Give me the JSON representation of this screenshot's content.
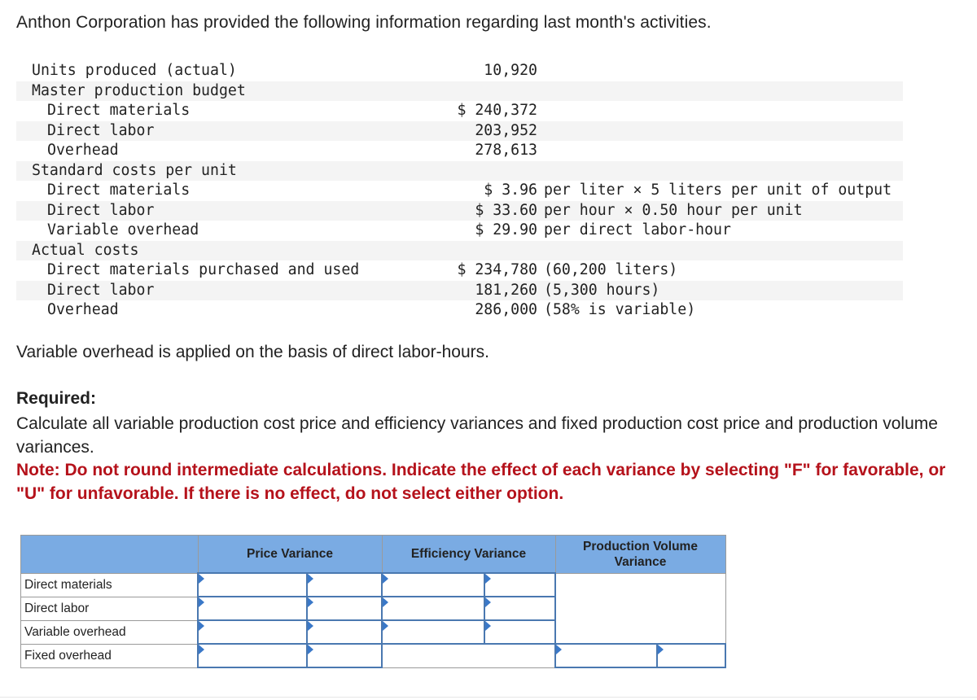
{
  "intro": "Anthon Corporation has provided the following information regarding last month's activities.",
  "data_rows": [
    {
      "label": "Units produced (actual)",
      "indent": false,
      "value": "10,920",
      "desc": ""
    },
    {
      "label": "Master production budget",
      "indent": false,
      "value": "",
      "desc": ""
    },
    {
      "label": "Direct materials",
      "indent": true,
      "value": "$ 240,372",
      "desc": ""
    },
    {
      "label": "Direct labor",
      "indent": true,
      "value": "203,952",
      "desc": ""
    },
    {
      "label": "Overhead",
      "indent": true,
      "value": "278,613",
      "desc": ""
    },
    {
      "label": "Standard costs per unit",
      "indent": false,
      "value": "",
      "desc": ""
    },
    {
      "label": "Direct materials",
      "indent": true,
      "value": "$ 3.96",
      "desc": "per liter × 5 liters per unit of output"
    },
    {
      "label": "Direct labor",
      "indent": true,
      "value": "$ 33.60",
      "desc": "per hour × 0.50 hour per unit"
    },
    {
      "label": "Variable overhead",
      "indent": true,
      "value": "$ 29.90",
      "desc": "per direct labor-hour"
    },
    {
      "label": "Actual costs",
      "indent": false,
      "value": "",
      "desc": ""
    },
    {
      "label": "Direct materials purchased and used",
      "indent": true,
      "value": "$ 234,780",
      "desc": "(60,200 liters)"
    },
    {
      "label": "Direct labor",
      "indent": true,
      "value": "181,260",
      "desc": "(5,300 hours)"
    },
    {
      "label": "Overhead",
      "indent": true,
      "value": "286,000",
      "desc": "(58% is variable)"
    }
  ],
  "variable_note": "Variable overhead is applied on the basis of direct labor-hours.",
  "required_heading": "Required:",
  "required_text": "Calculate all variable production cost price and efficiency variances and fixed production cost price and production volume variances.",
  "note_text": "Note: Do not round intermediate calculations. Indicate the effect of each variance by selecting \"F\" for favorable, or \"U\" for unfavorable. If there is no effect, do not select either option.",
  "answer_table": {
    "headers": [
      "",
      "Price Variance",
      "Efficiency Variance",
      "Production Volume Variance"
    ],
    "rows": [
      {
        "label": "Direct materials",
        "price_amount": "",
        "price_effect": "",
        "efficiency_amount": "",
        "efficiency_effect": ""
      },
      {
        "label": "Direct labor",
        "price_amount": "",
        "price_effect": "",
        "efficiency_amount": "",
        "efficiency_effect": ""
      },
      {
        "label": "Variable overhead",
        "price_amount": "",
        "price_effect": "",
        "efficiency_amount": "",
        "efficiency_effect": ""
      },
      {
        "label": "Fixed overhead",
        "price_amount": "",
        "price_effect": "",
        "volume_amount": "",
        "volume_effect": ""
      }
    ]
  },
  "colors": {
    "header_blue": "#7aabe3",
    "note_red": "#b5121b",
    "input_border": "#4a78b0",
    "stripe": "#f4f4f4"
  }
}
